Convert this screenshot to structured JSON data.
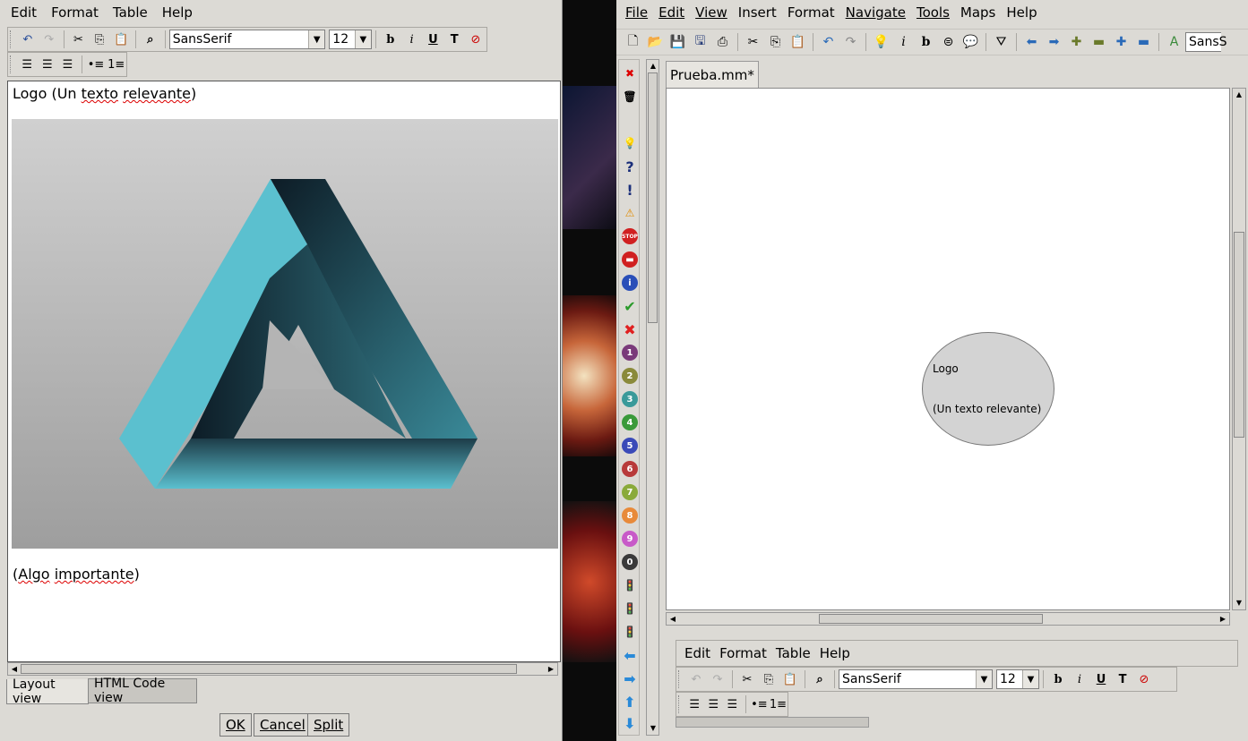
{
  "left_dialog": {
    "menu": [
      "Edit",
      "Format",
      "Table",
      "Help"
    ],
    "font_family": "SansSerif",
    "font_size": "12",
    "editor_line1_prefix": "Logo (Un ",
    "editor_line1_word1": "texto",
    "editor_line1_space": " ",
    "editor_line1_word2": "relevante",
    "editor_line1_suffix": ")",
    "editor_line2_prefix": "(",
    "editor_line2_word1": "Algo",
    "editor_line2_space": " ",
    "editor_line2_word2": "importante",
    "editor_line2_suffix": ")",
    "tabs": [
      "Layout view",
      "HTML Code view"
    ],
    "buttons": {
      "ok": "OK",
      "cancel": "Cancel",
      "split": "Split"
    },
    "triangle_colors": {
      "light": "#5bc0cf",
      "dark": "#0d1c26"
    }
  },
  "right_window": {
    "menu": [
      "File",
      "Edit",
      "View",
      "Insert",
      "Format",
      "Navigate",
      "Tools",
      "Maps",
      "Help"
    ],
    "font_family": "SansS",
    "map_tab": "Prueba.mm*",
    "node": {
      "line1": "Logo",
      "line2": "(Un texto relevante)",
      "fill": "#d3d3d3"
    },
    "note_menu": [
      "Edit",
      "Format",
      "Table",
      "Help"
    ],
    "note_font_family": "SansSerif",
    "note_font_size": "12",
    "icon_numbers": [
      "1",
      "2",
      "3",
      "4",
      "5",
      "6",
      "7",
      "8",
      "9",
      "0"
    ]
  }
}
